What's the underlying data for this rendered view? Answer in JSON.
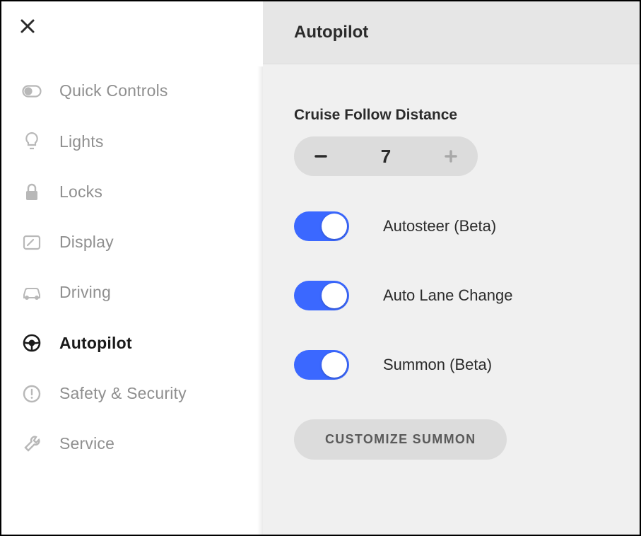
{
  "sidebar": {
    "items": [
      {
        "label": "Quick Controls",
        "icon": "toggle-icon",
        "active": false
      },
      {
        "label": "Lights",
        "icon": "bulb-icon",
        "active": false
      },
      {
        "label": "Locks",
        "icon": "lock-icon",
        "active": false
      },
      {
        "label": "Display",
        "icon": "display-icon",
        "active": false
      },
      {
        "label": "Driving",
        "icon": "car-icon",
        "active": false
      },
      {
        "label": "Autopilot",
        "icon": "wheel-icon",
        "active": true
      },
      {
        "label": "Safety & Security",
        "icon": "alert-icon",
        "active": false
      },
      {
        "label": "Service",
        "icon": "wrench-icon",
        "active": false
      }
    ]
  },
  "main": {
    "title": "Autopilot",
    "cruise": {
      "label": "Cruise Follow Distance",
      "value": "7"
    },
    "toggles": [
      {
        "label": "Autosteer (Beta)",
        "on": true
      },
      {
        "label": "Auto Lane Change",
        "on": true
      },
      {
        "label": "Summon (Beta)",
        "on": true
      }
    ],
    "customize_button": "CUSTOMIZE SUMMON"
  }
}
